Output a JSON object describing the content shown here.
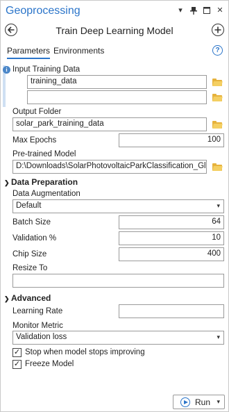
{
  "app_title": "Geoprocessing",
  "tool_title": "Train Deep Learning Model",
  "tabs": {
    "parameters": "Parameters",
    "environments": "Environments"
  },
  "params": {
    "input_training_data": {
      "label": "Input Training Data",
      "values": [
        "training_data",
        ""
      ]
    },
    "output_folder": {
      "label": "Output Folder",
      "value": "solar_park_training_data"
    },
    "max_epochs": {
      "label": "Max Epochs",
      "value": "100"
    },
    "pretrained_model": {
      "label": "Pre-trained Model",
      "value": "D:\\Downloads\\SolarPhotovoltaicParkClassification_Global"
    }
  },
  "data_preparation": {
    "section_label": "Data Preparation",
    "augmentation": {
      "label": "Data Augmentation",
      "value": "Default"
    },
    "batch_size": {
      "label": "Batch Size",
      "value": "64"
    },
    "validation_pct": {
      "label": "Validation %",
      "value": "10"
    },
    "chip_size": {
      "label": "Chip Size",
      "value": "400"
    },
    "resize_to": {
      "label": "Resize To",
      "value": ""
    }
  },
  "advanced": {
    "section_label": "Advanced",
    "learning_rate": {
      "label": "Learning Rate",
      "value": ""
    },
    "monitor_metric": {
      "label": "Monitor Metric",
      "value": "Validation loss"
    },
    "stop_early": {
      "label": "Stop when model stops improving",
      "checked": true
    },
    "freeze_model": {
      "label": "Freeze Model",
      "checked": true
    }
  },
  "run_button": {
    "label": "Run"
  },
  "icons": {
    "title_bar": [
      "chevron-down-icon",
      "pin-icon",
      "maximize-icon",
      "close-icon"
    ],
    "back": "back-arrow-icon",
    "add": "add-icon",
    "help": "help-icon",
    "info": "info-icon",
    "folder": "folder-icon",
    "run": "play-icon"
  },
  "colors": {
    "accent": "#2a74c9",
    "folder": "#e6b23c"
  }
}
